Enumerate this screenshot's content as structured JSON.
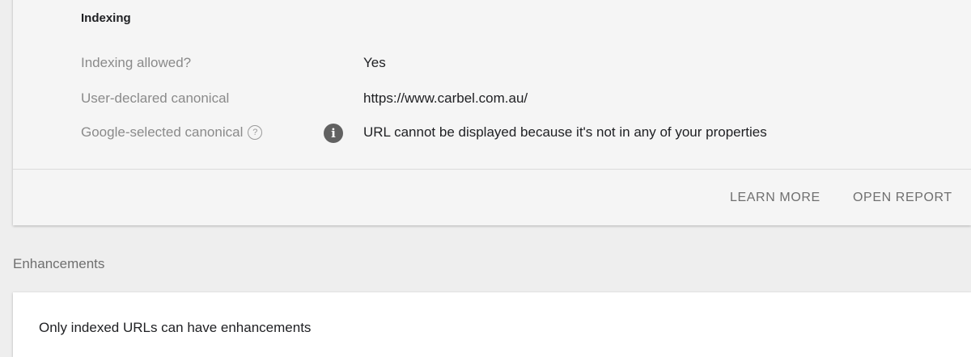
{
  "indexing": {
    "title": "Indexing",
    "rows": [
      {
        "label": "Indexing allowed?",
        "value": "Yes"
      },
      {
        "label": "User-declared canonical",
        "value": "https://www.carbel.com.au/"
      },
      {
        "label": "Google-selected canonical",
        "value": "URL cannot be displayed because it's not in any of your properties",
        "help_icon": "help-circle-icon",
        "status_icon": "info-icon"
      }
    ],
    "actions": {
      "learn_more": "LEARN MORE",
      "open_report": "OPEN REPORT"
    }
  },
  "enhancements": {
    "heading": "Enhancements",
    "message": "Only indexed URLs can have enhancements"
  },
  "colors": {
    "card_background": "#f5f5f5",
    "page_background": "#eeeeee",
    "label_text": "#8a8a8a",
    "value_text": "#202124",
    "info_icon": "#616161"
  }
}
